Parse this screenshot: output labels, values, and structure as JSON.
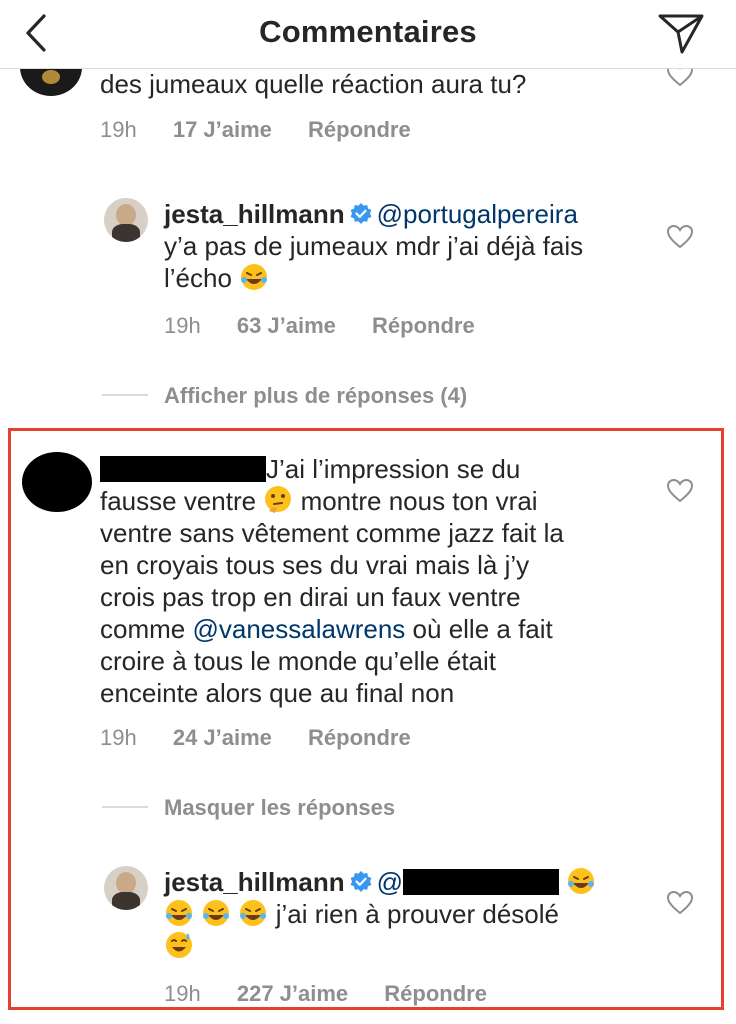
{
  "header": {
    "title": "Commentaires"
  },
  "comments": {
    "c0": {
      "text": "des jumeaux quelle réaction aura tu?",
      "time": "19h",
      "likes": "17 J’aime",
      "reply": "Répondre"
    },
    "r1": {
      "username": "jesta_hillmann",
      "mention": "@portugalpereira",
      "text_line1": "y’a pas de jumeaux mdr j’ai déjà fais",
      "text_line2": "l’écho",
      "time": "19h",
      "likes": "63 J’aime",
      "reply": "Répondre"
    },
    "more_replies": "Afficher plus de réponses (4)",
    "c2": {
      "line1": "J’ai l’impression se du",
      "line2a": "fausse ventre",
      "line2b": "montre nous ton vrai",
      "line3": "ventre sans vêtement comme jazz fait la",
      "line4": "en croyais tous ses du vrai mais là j’y",
      "line5": "crois pas trop en dirai un faux ventre",
      "line6a": "comme",
      "mention": "@vanessalawrens",
      "line6b": "où elle a fait",
      "line7": "croire à tous le monde qu’elle était",
      "line8": "enceinte alors que au final non",
      "time": "19h",
      "likes": "24 J’aime",
      "reply": "Répondre"
    },
    "hide_replies": "Masquer les réponses",
    "r3": {
      "username": "jesta_hillmann",
      "mention_prefix": "@",
      "text": "j’ai rien à prouver désolé",
      "time": "19h",
      "likes": "227 J’aime",
      "reply": "Répondre"
    }
  },
  "colors": {
    "accent_mention": "#00376b",
    "verified": "#3897f0",
    "highlight": "#e7402e"
  }
}
